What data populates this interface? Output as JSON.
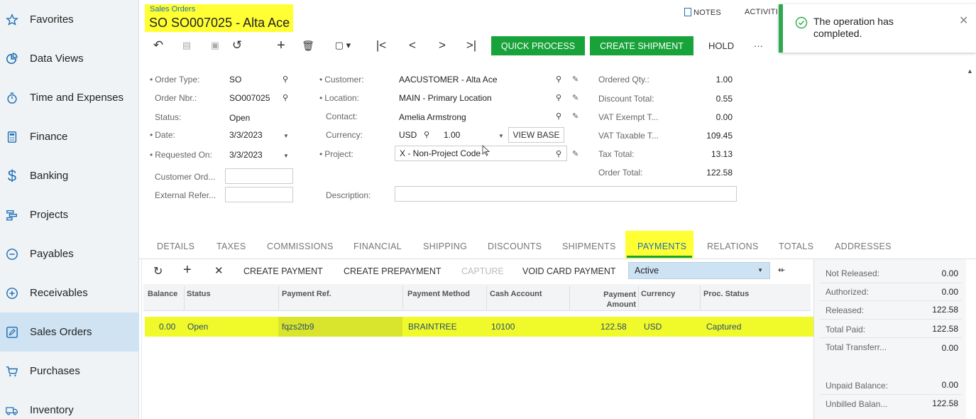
{
  "sidebar": {
    "items": [
      {
        "label": "Favorites",
        "icon": "star-icon"
      },
      {
        "label": "Data Views",
        "icon": "pie-chart-icon"
      },
      {
        "label": "Time and Expenses",
        "icon": "stopwatch-icon"
      },
      {
        "label": "Finance",
        "icon": "calculator-icon"
      },
      {
        "label": "Banking",
        "icon": "dollar-icon"
      },
      {
        "label": "Projects",
        "icon": "gantt-icon"
      },
      {
        "label": "Payables",
        "icon": "minus-circle-icon"
      },
      {
        "label": "Receivables",
        "icon": "plus-circle-icon"
      },
      {
        "label": "Sales Orders",
        "icon": "edit-square-icon",
        "active": true
      },
      {
        "label": "Purchases",
        "icon": "cart-icon"
      },
      {
        "label": "Inventory",
        "icon": "truck-icon"
      }
    ]
  },
  "header": {
    "breadcrumb": "Sales Orders",
    "title": "SO SO007025 - Alta Ace",
    "notes": "NOTES",
    "activities": "ACTIVITI"
  },
  "toolbar": {
    "quick_process": "QUICK PROCESS",
    "create_shipment": "CREATE SHIPMENT",
    "hold": "HOLD",
    "more": "···"
  },
  "toast": {
    "message": "The operation has completed."
  },
  "form": {
    "order_type_label": "Order Type:",
    "order_type": "SO",
    "order_nbr_label": "Order Nbr.:",
    "order_nbr": "SO007025",
    "status_label": "Status:",
    "status": "Open",
    "date_label": "Date:",
    "date": "3/3/2023",
    "requested_on_label": "Requested On:",
    "requested_on": "3/3/2023",
    "customer_ord_label": "Customer Ord...",
    "customer_ord": "",
    "external_ref_label": "External Refer...",
    "external_ref": "",
    "customer_label": "Customer:",
    "customer": "AACUSTOMER - Alta Ace",
    "location_label": "Location:",
    "location": "MAIN - Primary Location",
    "contact_label": "Contact:",
    "contact": "Amelia Armstrong",
    "currency_label": "Currency:",
    "currency": "USD",
    "rate": "1.00",
    "view_base": "VIEW BASE",
    "project_label": "Project:",
    "project": "X - Non-Project Code",
    "description_label": "Description:",
    "description": ""
  },
  "totals": {
    "ordered_qty_label": "Ordered Qty.:",
    "ordered_qty": "1.00",
    "discount_total_label": "Discount Total:",
    "discount_total": "0.55",
    "vat_exempt_label": "VAT Exempt T...",
    "vat_exempt": "0.00",
    "vat_taxable_label": "VAT Taxable T...",
    "vat_taxable": "109.45",
    "tax_total_label": "Tax Total:",
    "tax_total": "13.13",
    "order_total_label": "Order Total:",
    "order_total": "122.58"
  },
  "tabs": [
    "DETAILS",
    "TAXES",
    "COMMISSIONS",
    "FINANCIAL",
    "SHIPPING",
    "DISCOUNTS",
    "SHIPMENTS",
    "PAYMENTS",
    "RELATIONS",
    "TOTALS",
    "ADDRESSES"
  ],
  "grid_toolbar": {
    "create_payment": "CREATE PAYMENT",
    "create_prepayment": "CREATE PREPAYMENT",
    "capture": "CAPTURE",
    "void_card_payment": "VOID CARD PAYMENT",
    "filter_value": "Active"
  },
  "grid": {
    "headers": {
      "balance": "Balance",
      "status": "Status",
      "payment_ref": "Payment Ref.",
      "payment_method": "Payment Method",
      "cash_account": "Cash Account",
      "payment_amount": "Payment Amount",
      "currency": "Currency",
      "proc_status": "Proc. Status"
    },
    "rows": [
      {
        "balance": "0.00",
        "status": "Open",
        "payment_ref": "fqzs2tb9",
        "payment_method": "BRAINTREE",
        "cash_account": "10100",
        "payment_amount": "122.58",
        "currency": "USD",
        "proc_status": "Captured"
      }
    ]
  },
  "summary": {
    "not_released_label": "Not Released:",
    "not_released": "0.00",
    "authorized_label": "Authorized:",
    "authorized": "0.00",
    "released_label": "Released:",
    "released": "122.58",
    "total_paid_label": "Total Paid:",
    "total_paid": "122.58",
    "total_transferred_label": "Total Transferr...",
    "total_transferred": "0.00",
    "unpaid_balance_label": "Unpaid Balance:",
    "unpaid_balance": "0.00",
    "unbilled_balance_label": "Unbilled Balan...",
    "unbilled_balance": "122.58"
  },
  "colors": {
    "accent_blue": "#1e6fb5",
    "action_green": "#18a23a",
    "highlight_yellow": "#ffff33"
  }
}
